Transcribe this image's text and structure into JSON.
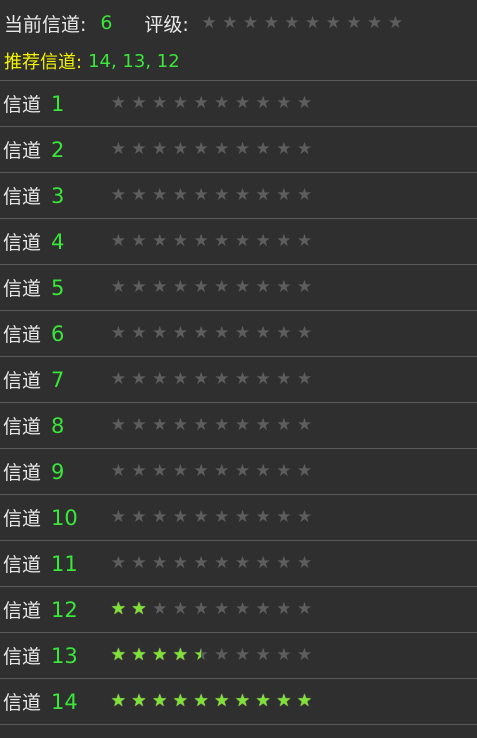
{
  "header": {
    "current_label": "当前信道:",
    "current_channel": "6",
    "rating_label": "评级:",
    "rating_stars": 0,
    "recommend_label": "推荐信道:",
    "recommend_value": "14, 13, 12"
  },
  "channels": [
    {
      "label": "信道",
      "number": "1",
      "stars": 0
    },
    {
      "label": "信道",
      "number": "2",
      "stars": 0
    },
    {
      "label": "信道",
      "number": "3",
      "stars": 0
    },
    {
      "label": "信道",
      "number": "4",
      "stars": 0
    },
    {
      "label": "信道",
      "number": "5",
      "stars": 0
    },
    {
      "label": "信道",
      "number": "6",
      "stars": 0
    },
    {
      "label": "信道",
      "number": "7",
      "stars": 0
    },
    {
      "label": "信道",
      "number": "8",
      "stars": 0
    },
    {
      "label": "信道",
      "number": "9",
      "stars": 0
    },
    {
      "label": "信道",
      "number": "10",
      "stars": 0
    },
    {
      "label": "信道",
      "number": "11",
      "stars": 0
    },
    {
      "label": "信道",
      "number": "12",
      "stars": 2
    },
    {
      "label": "信道",
      "number": "13",
      "stars": 4.5
    },
    {
      "label": "信道",
      "number": "14",
      "stars": 10
    }
  ],
  "max_stars": 10,
  "colors": {
    "background": "#2f2f2f",
    "channel_number": "#39e639",
    "recommend_label": "#f4f400",
    "star_on": "#7ee335",
    "star_off": "#5d5d5d",
    "divider": "#5a5a5a"
  }
}
